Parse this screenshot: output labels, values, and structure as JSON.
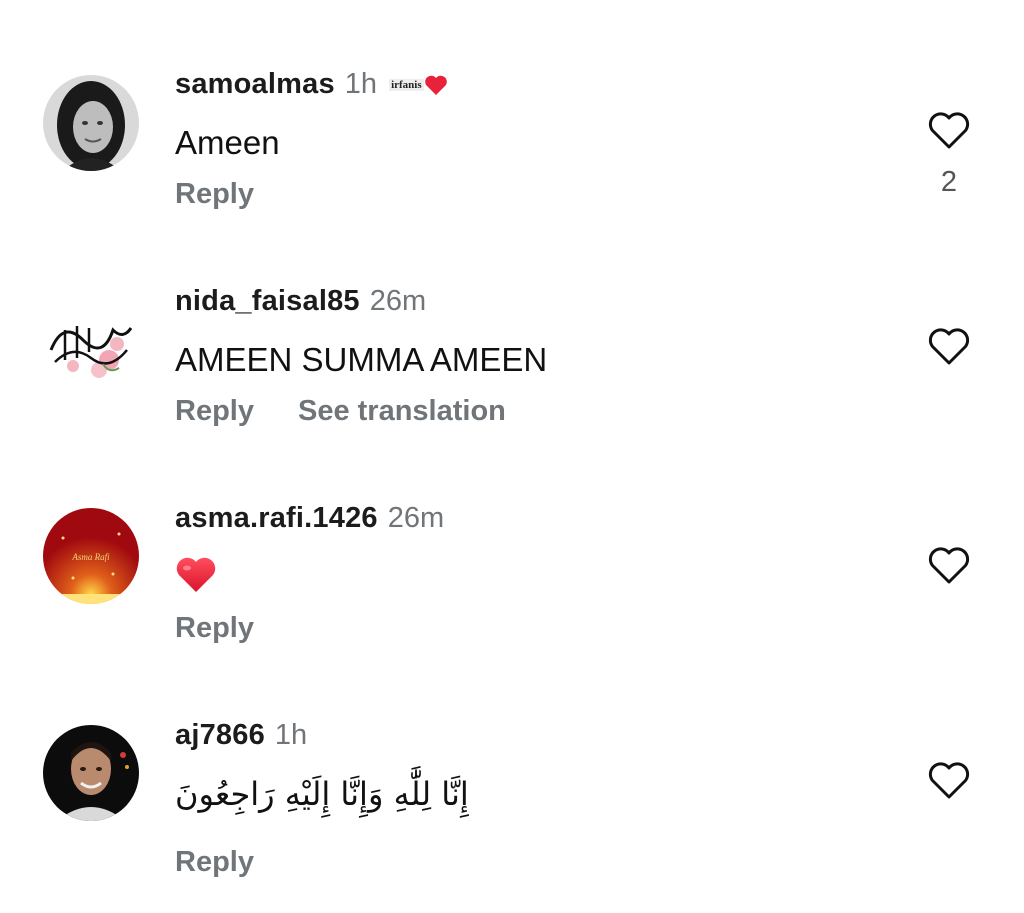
{
  "comments": [
    {
      "username": "samoalmas",
      "time": "1h",
      "badge_text": "irfanis",
      "text": "Ameen",
      "reply_label": "Reply",
      "like_count": "2"
    },
    {
      "username": "nida_faisal85",
      "time": "26m",
      "text": "AMEEN SUMMA AMEEN",
      "reply_label": "Reply",
      "translate_label": "See translation"
    },
    {
      "username": "asma.rafi.1426",
      "time": "26m",
      "text_emoji": "red-heart",
      "avatar_text": "Asma Rafi",
      "reply_label": "Reply"
    },
    {
      "username": "aj7866",
      "time": "1h",
      "text": "إِنَّا لِلَّٰهِ وَإِنَّا إِلَيْهِ رَاجِعُونَ",
      "reply_label": "Reply"
    }
  ],
  "icons": {
    "like": "heart-outline-icon",
    "badge_heart": "red-heart-icon"
  },
  "colors": {
    "muted": "#70757a",
    "heart_red": "#e8223a"
  }
}
